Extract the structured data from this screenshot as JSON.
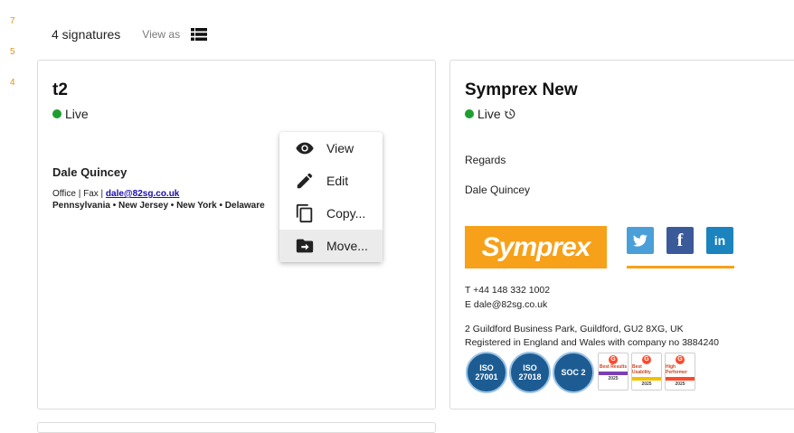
{
  "gutter": [
    "7",
    "5",
    "4"
  ],
  "header": {
    "count": "4 signatures",
    "view_as": "View as"
  },
  "cards": [
    {
      "title": "t2",
      "status": "Live",
      "signature": {
        "name": "Dale Quincey",
        "prefix": "Office | Fax | ",
        "email": "dale@82sg.co.uk",
        "regions": "Pennsylvania • New Jersey • New York • Delaware"
      }
    },
    {
      "title": "Symprex New",
      "status": "Live",
      "signature": {
        "greeting": "Regards",
        "name": "Dale Quincey",
        "logo_text": "Symprex",
        "phone": "T +44 148 332 1002",
        "email": "E dale@82sg.co.uk",
        "address": "2 Guildford Business Park, Guildford, GU2 8XG, UK",
        "registration": "Registered in England and Wales with company no 3884240",
        "badges": [
          {
            "line1": "ISO",
            "line2": "27001"
          },
          {
            "line1": "ISO",
            "line2": "27018"
          },
          {
            "line1": "SOC 2",
            "line2": ""
          }
        ],
        "g2_badges": [
          {
            "label": "Best Results",
            "season": "WINTER",
            "year": "2025",
            "color": "#7b3fb5"
          },
          {
            "label": "Best Usability",
            "season": "WINTER",
            "year": "2025",
            "color": "#f2c200"
          },
          {
            "label": "High Performer",
            "season": "WINTER",
            "year": "2025",
            "color": "#ff492c"
          }
        ]
      }
    }
  ],
  "context_menu": {
    "items": [
      {
        "label": "View",
        "icon": "eye-icon"
      },
      {
        "label": "Edit",
        "icon": "pencil-icon"
      },
      {
        "label": "Copy...",
        "icon": "copy-icon"
      },
      {
        "label": "Move...",
        "icon": "move-folder-icon"
      }
    ],
    "hovered_index": 3
  },
  "colors": {
    "live": "#1e9e2f",
    "brand_orange": "#f7a11a",
    "menu_hover": "#ebebeb"
  }
}
